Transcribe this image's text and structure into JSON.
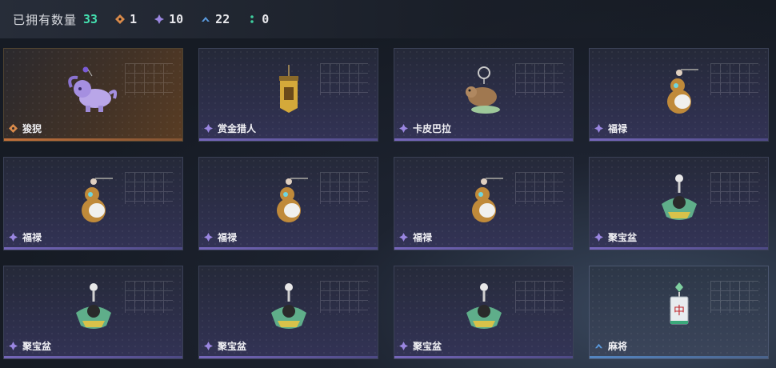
{
  "header": {
    "title": "已拥有数量",
    "total": "33",
    "stats": [
      {
        "icon": "orange-diamond-icon",
        "value": "1",
        "color": "#d98a4a"
      },
      {
        "icon": "purple-diamond-icon",
        "value": "10",
        "color": "#9a86e0"
      },
      {
        "icon": "blue-chevron-icon",
        "value": "22",
        "color": "#5a9be0"
      },
      {
        "icon": "green-dots-icon",
        "value": "0",
        "color": "#3fcf9f"
      }
    ]
  },
  "items": [
    {
      "name": "狻猊",
      "rarity": "orange",
      "art": "lion-charm"
    },
    {
      "name": "赏金猎人",
      "rarity": "purple",
      "art": "scroll-charm"
    },
    {
      "name": "卡皮巴拉",
      "rarity": "purple",
      "art": "capybara-charm"
    },
    {
      "name": "福禄",
      "rarity": "purple",
      "art": "gourd-charm"
    },
    {
      "name": "福禄",
      "rarity": "purple",
      "art": "gourd-charm"
    },
    {
      "name": "福禄",
      "rarity": "purple",
      "art": "gourd-charm"
    },
    {
      "name": "福禄",
      "rarity": "purple",
      "art": "gourd-charm"
    },
    {
      "name": "聚宝盆",
      "rarity": "purple",
      "art": "treasure-bowl-charm"
    },
    {
      "name": "聚宝盆",
      "rarity": "purple",
      "art": "treasure-bowl-charm"
    },
    {
      "name": "聚宝盆",
      "rarity": "purple",
      "art": "treasure-bowl-charm"
    },
    {
      "name": "聚宝盆",
      "rarity": "purple",
      "art": "treasure-bowl-charm"
    },
    {
      "name": "麻将",
      "rarity": "blue",
      "art": "mahjong-tile-charm",
      "tile_text": "中"
    }
  ]
}
